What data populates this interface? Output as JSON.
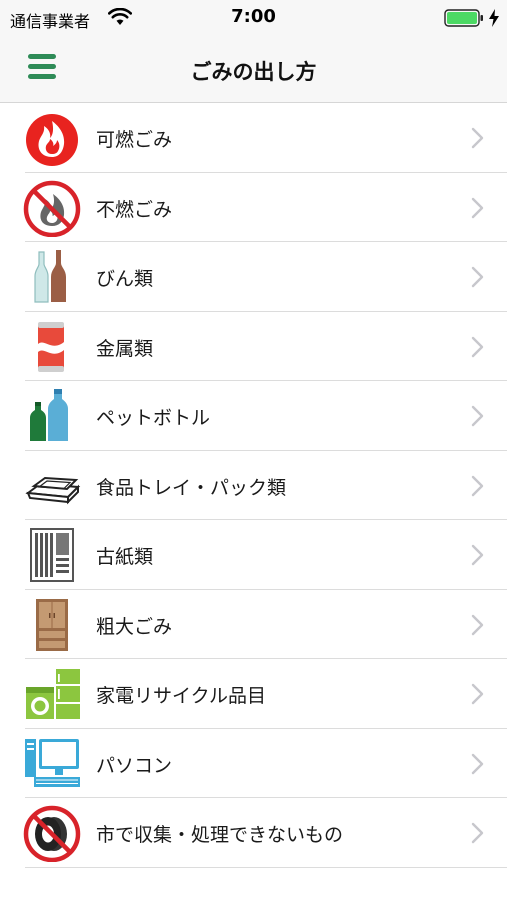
{
  "status_bar": {
    "carrier": "通信事業者",
    "time": "7:00",
    "icons": [
      "wifi-icon",
      "battery-icon",
      "charging-bolt-icon"
    ]
  },
  "nav_bar": {
    "title": "ごみの出し方",
    "menu_icon": "hamburger-menu-icon"
  },
  "colors": {
    "accent_green": "#2e8b57",
    "battery_green": "#4cd964",
    "prohibit_red": "#d8232a",
    "chevron_gray": "#c7c7cc"
  },
  "items": [
    {
      "label": "可燃ごみ",
      "icon": "flame-icon"
    },
    {
      "label": "不燃ごみ",
      "icon": "no-burn-icon"
    },
    {
      "label": "びん類",
      "icon": "bottles-icon"
    },
    {
      "label": "金属類",
      "icon": "can-icon"
    },
    {
      "label": "ペットボトル",
      "icon": "pet-bottle-icon"
    },
    {
      "label": "食品トレイ・パック類",
      "icon": "food-tray-icon"
    },
    {
      "label": "古紙類",
      "icon": "paper-stack-icon"
    },
    {
      "label": "粗大ごみ",
      "icon": "cabinet-icon"
    },
    {
      "label": "家電リサイクル品目",
      "icon": "appliances-icon"
    },
    {
      "label": "パソコン",
      "icon": "computer-icon"
    },
    {
      "label": "市で収集・処理できないもの",
      "icon": "no-tire-icon"
    }
  ]
}
